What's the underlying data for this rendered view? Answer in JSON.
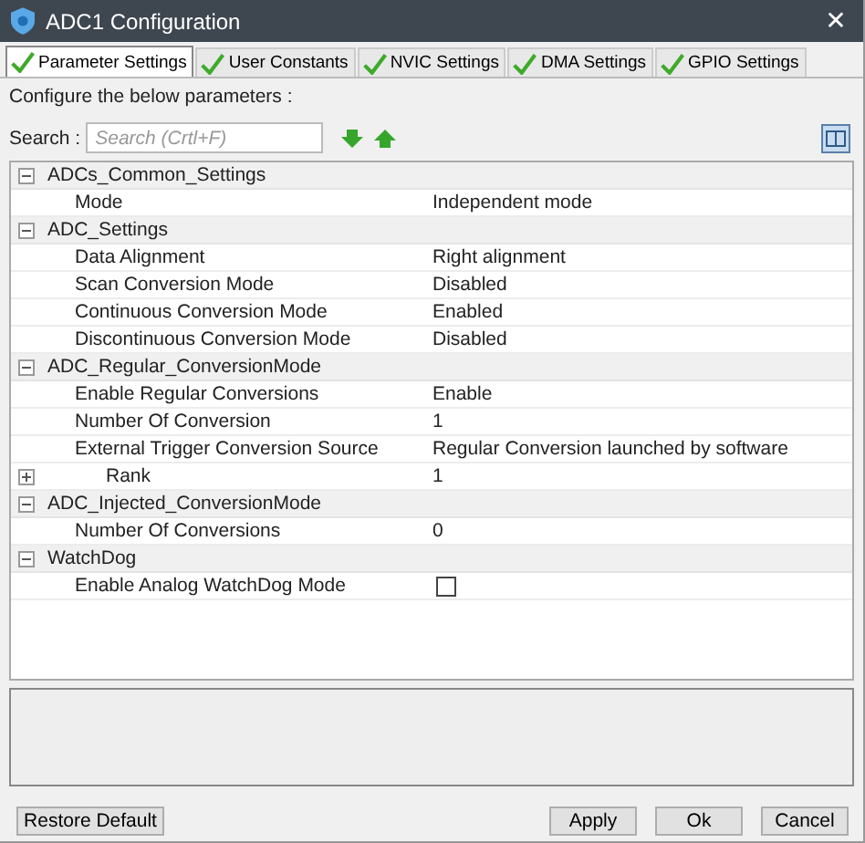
{
  "window": {
    "title": "ADC1 Configuration",
    "close": "✕"
  },
  "tabs": [
    {
      "label": "Parameter Settings",
      "selected": true
    },
    {
      "label": "User Constants",
      "selected": false
    },
    {
      "label": "NVIC Settings",
      "selected": false
    },
    {
      "label": "DMA Settings",
      "selected": false
    },
    {
      "label": "GPIO Settings",
      "selected": false
    }
  ],
  "instruction": "Configure the below parameters :",
  "search": {
    "label": "Search :",
    "placeholder": "Search (Crtl+F)"
  },
  "groups": [
    {
      "name": "ADCs_Common_Settings",
      "expanded": true,
      "params": [
        {
          "name": "Mode",
          "value": "Independent mode",
          "kind": "text"
        }
      ]
    },
    {
      "name": "ADC_Settings",
      "expanded": true,
      "params": [
        {
          "name": "Data Alignment",
          "value": "Right alignment",
          "kind": "text"
        },
        {
          "name": "Scan Conversion Mode",
          "value": "Disabled",
          "kind": "text"
        },
        {
          "name": "Continuous Conversion Mode",
          "value": "Enabled",
          "kind": "text"
        },
        {
          "name": "Discontinuous Conversion Mode",
          "value": "Disabled",
          "kind": "text"
        }
      ]
    },
    {
      "name": "ADC_Regular_ConversionMode",
      "expanded": true,
      "params": [
        {
          "name": "Enable Regular Conversions",
          "value": "Enable",
          "kind": "text"
        },
        {
          "name": "Number Of Conversion",
          "value": "1",
          "kind": "text"
        },
        {
          "name": "External Trigger Conversion Source",
          "value": "Regular Conversion launched by software",
          "kind": "text"
        },
        {
          "name": "Rank",
          "value": "1",
          "kind": "expandable",
          "expanded": false
        }
      ]
    },
    {
      "name": "ADC_Injected_ConversionMode",
      "expanded": true,
      "params": [
        {
          "name": "Number Of Conversions",
          "value": "0",
          "kind": "text"
        }
      ]
    },
    {
      "name": "WatchDog",
      "expanded": true,
      "params": [
        {
          "name": "Enable Analog WatchDog Mode",
          "kind": "checkbox",
          "checked": false
        }
      ]
    }
  ],
  "buttons": {
    "restore": "Restore Default",
    "actions": [
      "Apply",
      "Ok",
      "Cancel"
    ]
  }
}
